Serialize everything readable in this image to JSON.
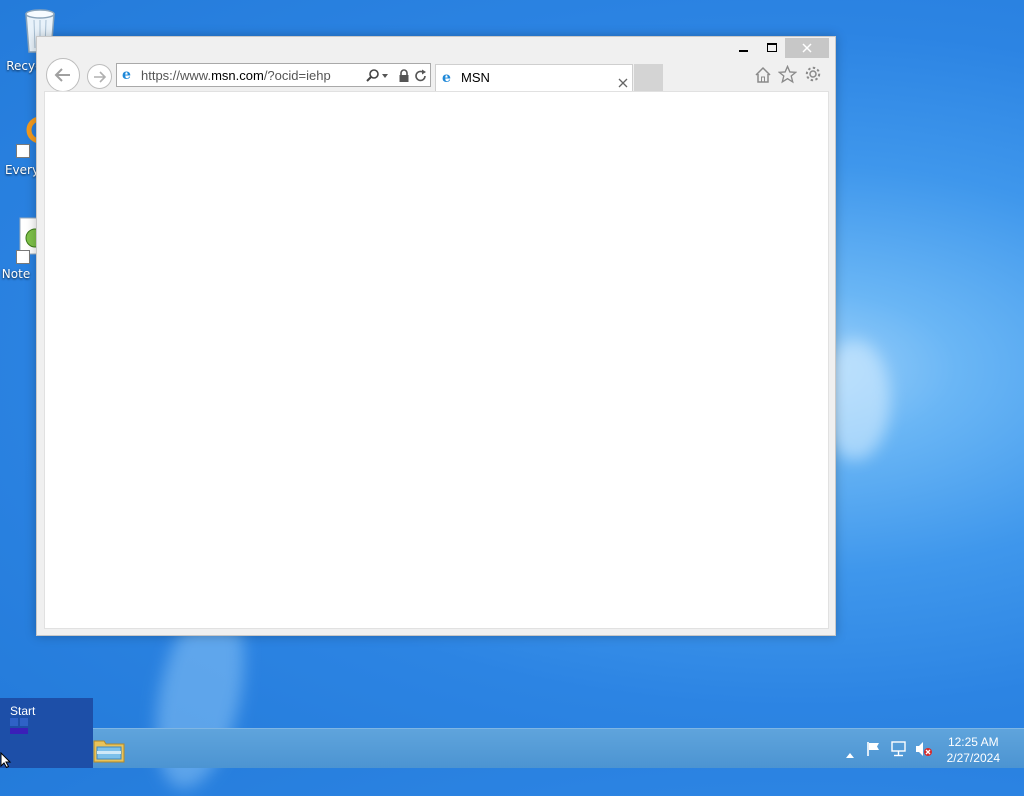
{
  "desktop": {
    "icons": [
      {
        "label": "Recyc",
        "icon": "recycle-bin-icon"
      },
      {
        "label": "Every",
        "icon": "everything-search-icon"
      },
      {
        "label": "Note",
        "icon": "notepad-plus-icon"
      }
    ]
  },
  "browser": {
    "address": {
      "prefix": "https://www.",
      "domain": "msn.com",
      "suffix": "/?ocid=iehp"
    },
    "tab_title": "MSN",
    "icons": [
      "back-icon",
      "forward-icon",
      "search-icon",
      "lock-icon",
      "refresh-icon",
      "close-tab-icon",
      "home-icon",
      "favorites-icon",
      "tools-gear-icon"
    ]
  },
  "taskbar": {
    "start_label": "Start",
    "time": "12:25 AM",
    "date": "2/27/2024",
    "pinned": [
      "file-explorer-icon"
    ],
    "tray": [
      "show-hidden-icons",
      "action-center-flag-icon",
      "network-icon",
      "volume-muted-icon"
    ]
  },
  "colors": {
    "accent": "#1d4fa8",
    "taskbar": "#5fa4dc",
    "desktop": "#2c84e3",
    "ie_blue": "#1e88d8"
  }
}
